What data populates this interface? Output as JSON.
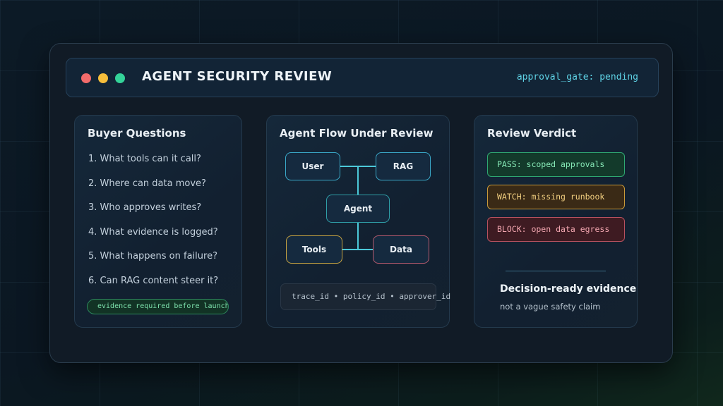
{
  "window": {
    "title": "AGENT SECURITY REVIEW",
    "status": "approval_gate: pending",
    "controls": [
      "close-dot",
      "minimize-dot",
      "maximize-dot"
    ]
  },
  "questions_panel": {
    "title": "Buyer Questions",
    "items": [
      "1. What tools can it call?",
      "2. Where can data move?",
      "3. Who approves writes?",
      "4. What evidence is logged?",
      "5. What happens on failure?",
      "6. Can RAG content steer it?"
    ],
    "tag": "evidence required before launch"
  },
  "flow_panel": {
    "title": "Agent Flow Under Review",
    "nodes": {
      "user": "User",
      "rag": "RAG",
      "agent": "Agent",
      "tools": "Tools",
      "data": "Data"
    },
    "trace": "trace_id • policy_id • approver_id"
  },
  "verdict_panel": {
    "title": "Review Verdict",
    "pass": "PASS: scoped approvals",
    "watch": "WATCH: missing runbook",
    "block": "BLOCK: open data egress",
    "summary_heading": "Decision-ready evidence",
    "summary_sub": "not a vague safety claim"
  },
  "colors": {
    "accent_cyan": "#5fd3e6",
    "pass_green": "#86e8b6",
    "watch_amber": "#f2cf80",
    "block_red": "#f4a7b1"
  }
}
